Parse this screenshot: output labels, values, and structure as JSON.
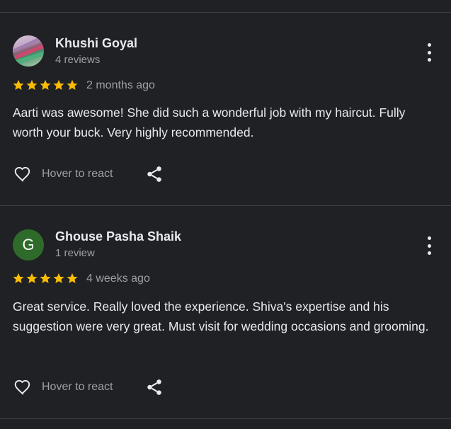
{
  "reviews": [
    {
      "name": "Khushi Goyal",
      "review_count": "4 reviews",
      "avatar_type": "photo",
      "avatar_letter": "",
      "rating": 5,
      "date": "2 months ago",
      "text": "Aarti was awesome! She did such a wonderful job with my haircut. Fully worth your buck. Very highly recommended.",
      "react_label": "Hover to react"
    },
    {
      "name": "Ghouse Pasha Shaik",
      "review_count": "1 review",
      "avatar_type": "letter",
      "avatar_letter": "G",
      "avatar_color": "#2e6b2a",
      "rating": 5,
      "date": "4 weeks ago",
      "text": "Great service. Really loved the experience. Shiva's expertise and his suggestion were very great. Must visit for wedding occasions and grooming.",
      "react_label": "Hover to react"
    }
  ],
  "colors": {
    "background": "#202124",
    "star": "#fbbc04",
    "divider": "#3c4043",
    "secondary_text": "#9aa0a6"
  },
  "icons": {
    "more": "more-vert-icon",
    "react": "heart-outline-icon",
    "share": "share-icon",
    "star": "star-icon"
  }
}
